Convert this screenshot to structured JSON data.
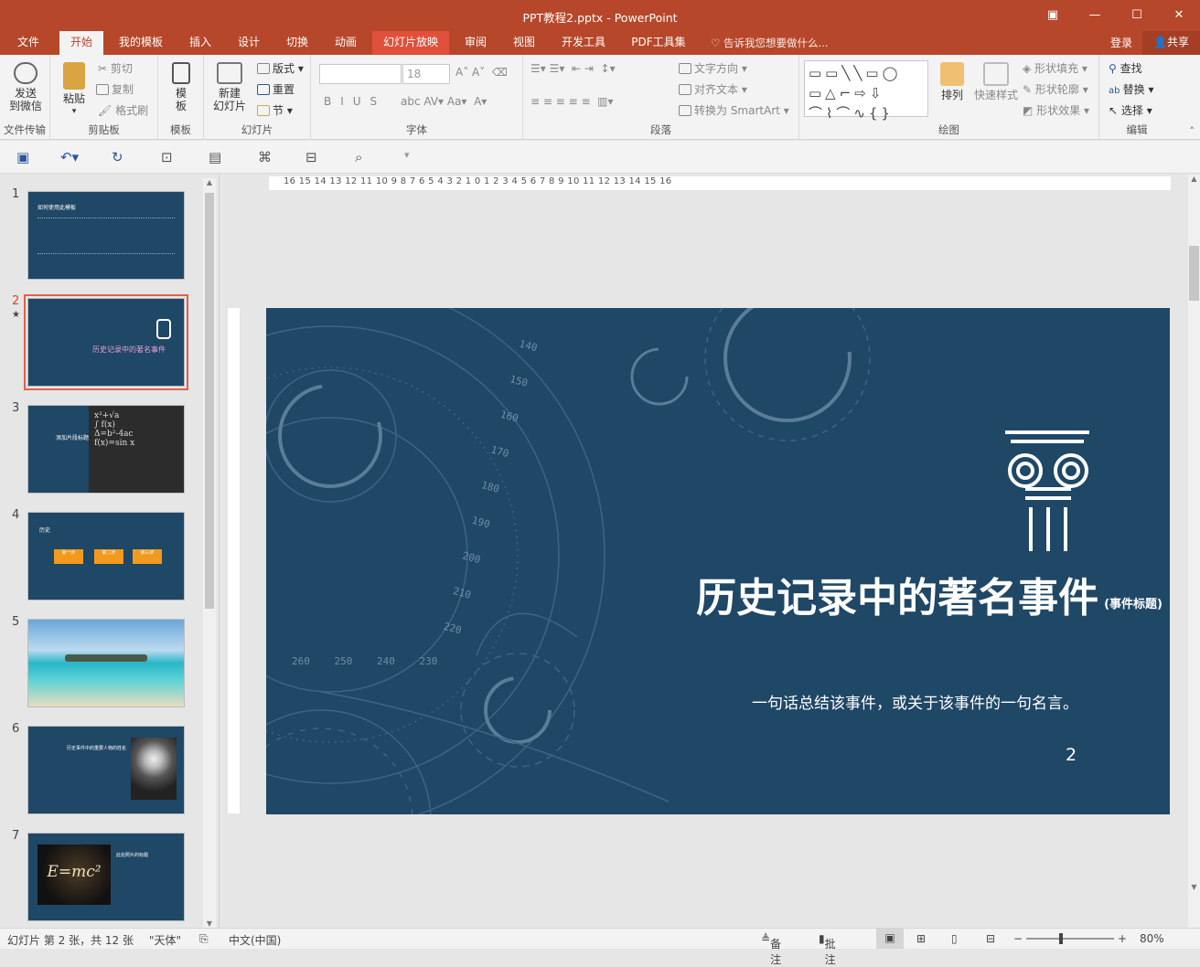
{
  "titlebar": {
    "title": "PPT教程2.pptx - PowerPoint"
  },
  "tabs": [
    {
      "label": "文件"
    },
    {
      "label": "开始"
    },
    {
      "label": "我的模板"
    },
    {
      "label": "插入"
    },
    {
      "label": "设计"
    },
    {
      "label": "切换"
    },
    {
      "label": "动画"
    },
    {
      "label": "幻灯片放映"
    },
    {
      "label": "审阅"
    },
    {
      "label": "视图"
    },
    {
      "label": "开发工具"
    },
    {
      "label": "PDF工具集"
    }
  ],
  "tellme": "告诉我您想要做什么...",
  "login": "登录",
  "share": "共享",
  "ribbon": {
    "file_transfer": {
      "btn": "发送\n到微信",
      "group": "文件传输"
    },
    "clipboard": {
      "paste": "粘贴",
      "cut": "剪切",
      "copy": "复制",
      "format_painter": "格式刷",
      "group": "剪贴板"
    },
    "template": {
      "btn": "模\n板",
      "group": "模板"
    },
    "slides": {
      "new": "新建\n幻灯片",
      "layout": "版式",
      "reset": "重置",
      "section": "节",
      "group": "幻灯片"
    },
    "font": {
      "size": "18",
      "group": "字体"
    },
    "paragraph": {
      "text_direction": "文字方向",
      "align_text": "对齐文本",
      "smartart": "转换为 SmartArt",
      "group": "段落"
    },
    "drawing": {
      "arrange": "排列",
      "quick_styles": "快速样式",
      "fill": "形状填充",
      "outline": "形状轮廓",
      "effects": "形状效果",
      "group": "绘图"
    },
    "editing": {
      "find": "查找",
      "replace": "替换",
      "select": "选择",
      "group": "编辑"
    }
  },
  "thumbs": [
    {
      "num": "1",
      "title": "如何使用此模板",
      "sel": false
    },
    {
      "num": "2",
      "title": "历史记录中的著名事件",
      "sel": true
    },
    {
      "num": "3",
      "title": "添加片段标题",
      "sel": false
    },
    {
      "num": "4",
      "title": "历史",
      "steps": [
        "第一步",
        "第二步",
        "第三步"
      ],
      "sel": false
    },
    {
      "num": "5",
      "title": "",
      "sel": false
    },
    {
      "num": "6",
      "title": "历史事件中的重要人物的姓名",
      "sel": false
    },
    {
      "num": "7",
      "title": "此处照片的标题",
      "formula": "E=mc²",
      "sel": false
    }
  ],
  "ruler_labels": "16 15 14 13 12 11 10 9 8 7 6 5 4 3 2 1 0 1 2 3 4 5 6 7 8 9 10 11 12 13 14 15 16",
  "slide": {
    "title": "历史记录中的著名事件",
    "title_note": "(事件标题)",
    "subtitle": "一句话总结该事件，或关于该事件的一句名言。",
    "number": "2",
    "dial_labels": [
      "140",
      "150",
      "160",
      "170",
      "180",
      "190",
      "200",
      "210",
      "220",
      "230",
      "240",
      "250",
      "260"
    ]
  },
  "status": {
    "slide_info": "幻灯片 第 2 张，共 12 张",
    "theme": "\"天体\"",
    "language": "中文(中国)",
    "notes": "备注",
    "comments": "批注",
    "zoom": "80%"
  },
  "colors": {
    "accent": "#b7472a",
    "slide_bg": "#1f4766",
    "thumb_sel": "#e0614a"
  }
}
